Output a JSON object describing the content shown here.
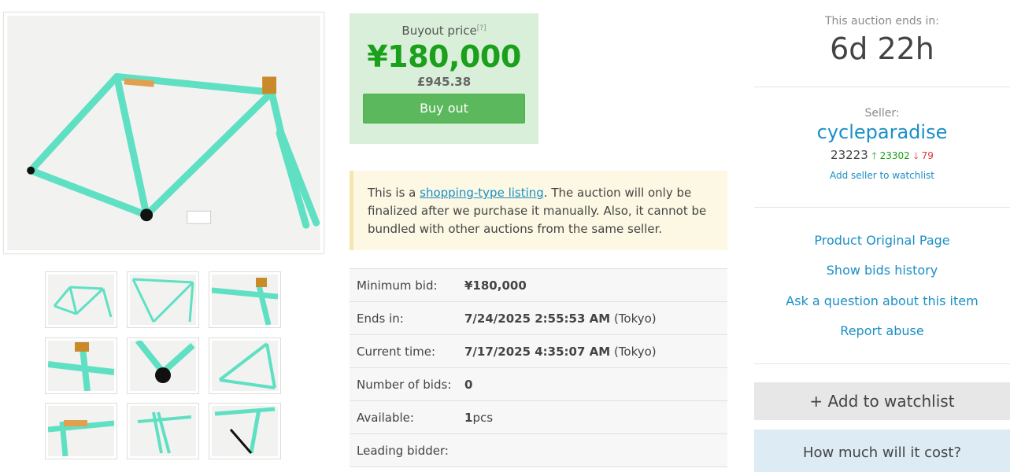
{
  "images": {
    "main_alt": "Bicycle frame main photo",
    "thumbnails": [
      "thumb-1",
      "thumb-2",
      "thumb-3",
      "thumb-4",
      "thumb-5",
      "thumb-6",
      "thumb-7",
      "thumb-8",
      "thumb-9"
    ]
  },
  "buyout": {
    "label": "Buyout price",
    "help": "[?]",
    "price": "¥180,000",
    "price_gbp": "£945.38",
    "button": "Buy out"
  },
  "notice": {
    "prefix": "This is a ",
    "link": "shopping-type listing",
    "suffix": ". The auction will only be finalized after we purchase it manually. Also, it cannot be bundled with other auctions from the same seller."
  },
  "details": {
    "min_bid_label": "Minimum bid:",
    "min_bid_value": "¥180,000",
    "ends_label": "Ends in:",
    "ends_value": "7/24/2025 2:55:53 AM",
    "ends_tz": " (Tokyo)",
    "current_label": "Current time:",
    "current_value": "7/17/2025 4:35:07 AM",
    "current_tz": " (Tokyo)",
    "bids_label": "Number of bids:",
    "bids_value": "0",
    "available_label": "Available:",
    "available_value": "1",
    "available_unit": "pcs",
    "leader_label": "Leading bidder:",
    "leader_value": ""
  },
  "sidebar": {
    "ends_label": "This auction ends in:",
    "ends_value": "6d 22h",
    "seller_label": "Seller:",
    "seller_name": "cycleparadise",
    "seller_score": "23223",
    "seller_pos": "23302",
    "seller_neg": "79",
    "add_seller_watch": "Add seller to watchlist",
    "links": [
      "Product Original Page",
      "Show bids history",
      "Ask a question about this item",
      "Report abuse"
    ],
    "add_watchlist": "+ Add to watchlist",
    "cost_button": "How much will it cost?"
  },
  "colors": {
    "accent_link": "#1a8fc6",
    "price_green": "#1aa01a",
    "button_green": "#5cb85c",
    "frame_mint": "#5fe0c3"
  }
}
